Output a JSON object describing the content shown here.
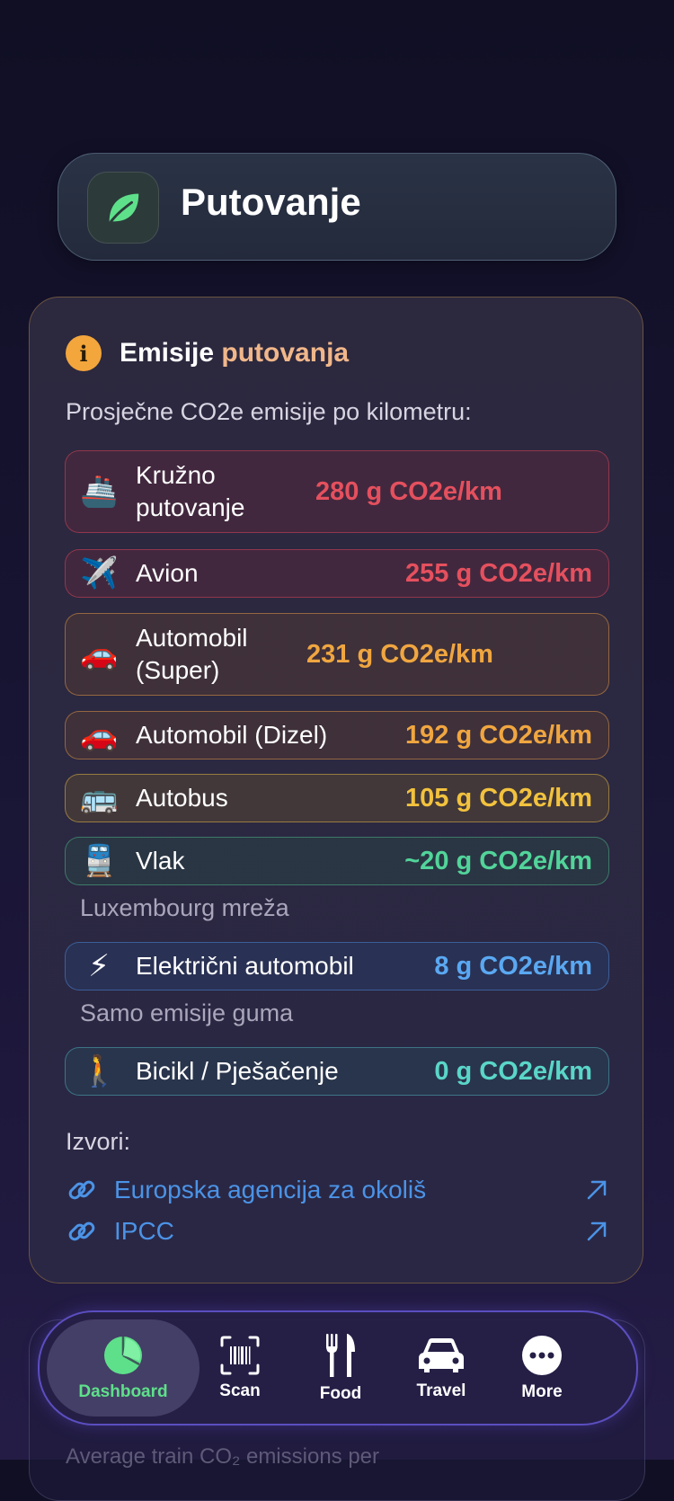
{
  "header": {
    "title": "Putovanje",
    "icon": "leaf-icon"
  },
  "card": {
    "title_part1": "Emisije",
    "title_part2": "putovanja",
    "subtitle": "Prosječne CO2e emisije po kilometru:",
    "rows": [
      {
        "emoji": "🚢",
        "label": "Kružno putovanje",
        "value": "280 g CO2e/km",
        "color": "#e5505e"
      },
      {
        "emoji": "✈️",
        "label": "Avion",
        "value": "255 g CO2e/km",
        "color": "#e5505e"
      },
      {
        "emoji": "🚗",
        "label": "Automobil (Super)",
        "value": "231 g CO2e/km",
        "color": "#f0a640"
      },
      {
        "emoji": "🚗",
        "label": "Automobil (Dizel)",
        "value": "192 g CO2e/km",
        "color": "#f0a640"
      },
      {
        "emoji": "🚌",
        "label": "Autobus",
        "value": "105 g CO2e/km",
        "color": "#f2c23e"
      },
      {
        "emoji": "🚆",
        "label": "Vlak",
        "value": "~20 g CO2e/km",
        "color": "#52d49a",
        "note": "Luxembourg mreža"
      },
      {
        "emoji": "⚡",
        "label": "Električni automobil",
        "value": "8 g CO2e/km",
        "color": "#5aa8f2",
        "note": "Samo emisije guma"
      },
      {
        "emoji": "🚶",
        "label": "Bicikl / Pješačenje",
        "value": "0 g CO2e/km",
        "color": "#5ad6c8"
      }
    ],
    "sources_title": "Izvori:",
    "sources": [
      {
        "label": "Europska agencija za okoliš"
      },
      {
        "label": "IPCC"
      }
    ]
  },
  "ghost": {
    "text": "Average train CO₂ emissions per"
  },
  "nav": {
    "items": [
      {
        "label": "Dashboard",
        "icon": "pie-chart-icon",
        "active": true
      },
      {
        "label": "Scan",
        "icon": "barcode-scan-icon"
      },
      {
        "label": "Food",
        "icon": "fork-knife-icon"
      },
      {
        "label": "Travel",
        "icon": "car-icon"
      },
      {
        "label": "More",
        "icon": "more-dots-icon"
      }
    ]
  },
  "colors": {
    "accent": "#5ee08a",
    "link": "#4b93e6",
    "warning": "#f3a63c"
  }
}
